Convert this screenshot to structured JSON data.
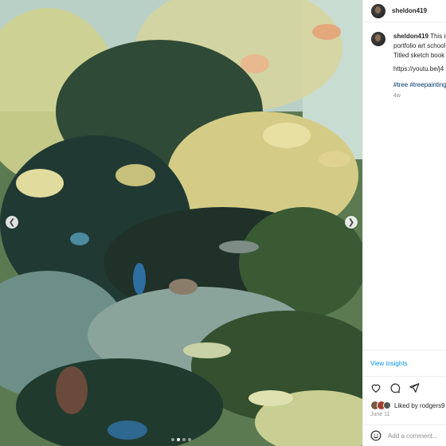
{
  "post": {
    "username": "sheldon419",
    "image_alt": "Painting",
    "carousel": {
      "slide_count": 4,
      "active_index": 1
    }
  },
  "caption": {
    "username": "sheldon419",
    "line1": "This is",
    "line2": "portfolio art school",
    "line3": "Titled sketch book",
    "link": "https://youtu.be/j4",
    "tags": "#tree #treepainting",
    "age": "4w"
  },
  "insights_label": "View insights",
  "likes_text": "Liked by rodgers9",
  "date": "June 11",
  "comment": {
    "placeholder": "Add a comment..."
  },
  "colors": {
    "link_blue": "#0095f6",
    "hashtag_blue": "#00376b",
    "muted": "#8e8e8e"
  },
  "icons": [
    "chevron-left-icon",
    "chevron-right-icon",
    "heart-icon",
    "comment-icon",
    "share-icon",
    "emoji-icon"
  ]
}
